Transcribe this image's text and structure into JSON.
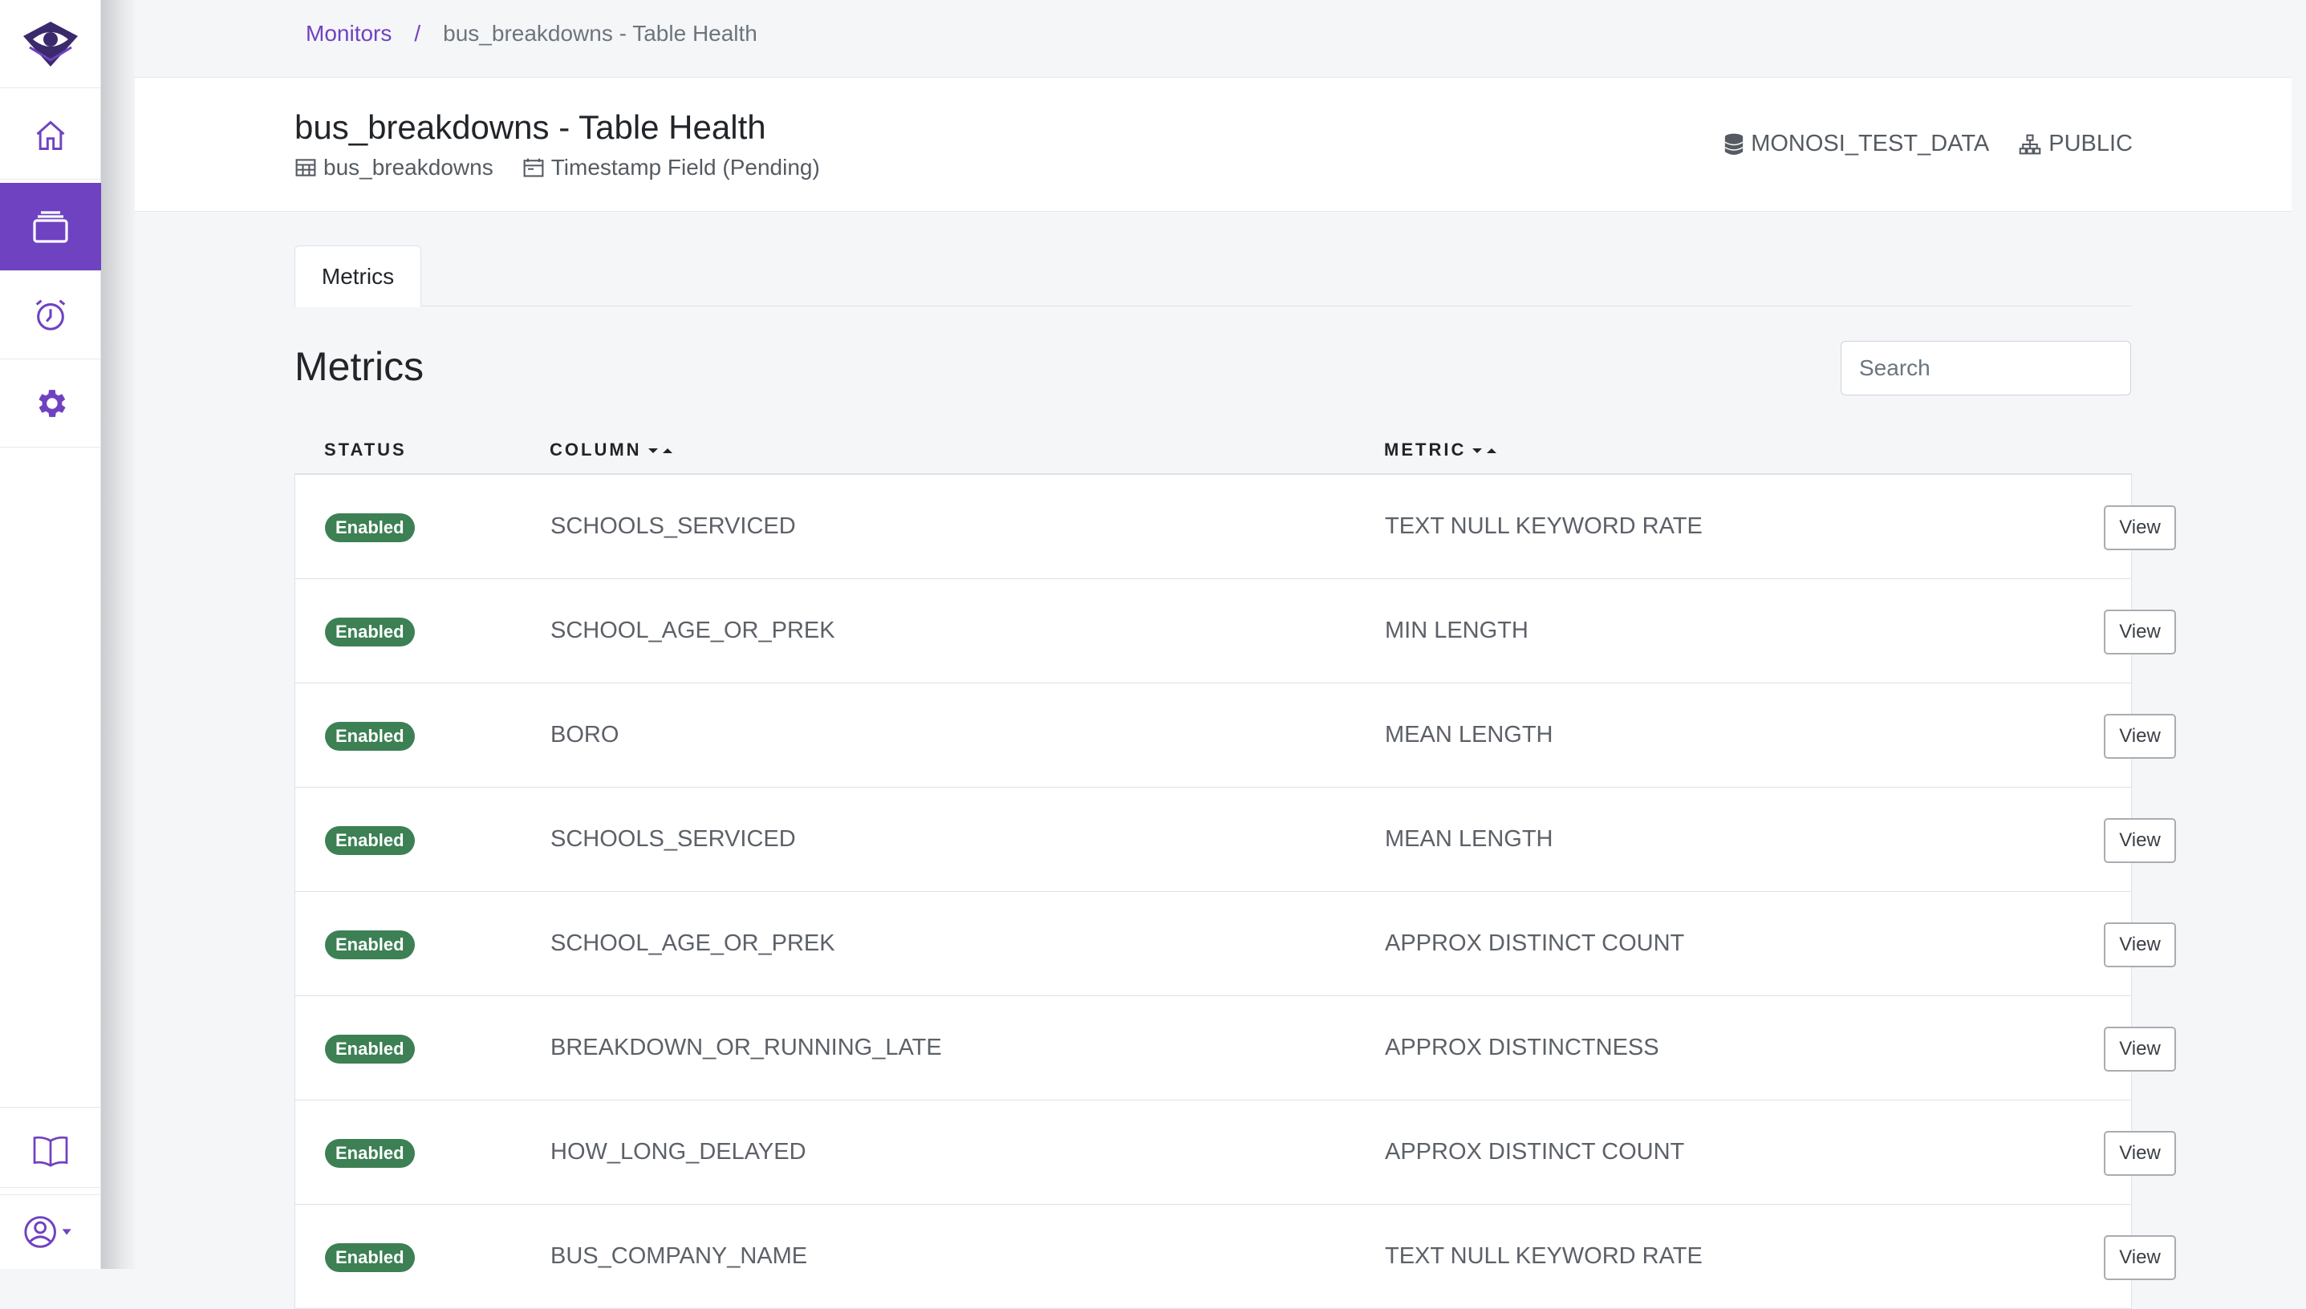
{
  "sidebar": {
    "items": [
      {
        "name": "logo-icon"
      },
      {
        "name": "home-icon"
      },
      {
        "name": "monitors-icon",
        "active": true
      },
      {
        "name": "alarm-clock-icon"
      },
      {
        "name": "gear-icon"
      },
      {
        "name": "book-icon"
      },
      {
        "name": "user-account-icon"
      }
    ],
    "accent_color": "#6f42c1"
  },
  "breadcrumb": {
    "root": "Monitors",
    "separator": "/",
    "current": "bus_breakdowns - Table Health"
  },
  "header": {
    "title": "bus_breakdowns - Table Health",
    "table_name": "bus_breakdowns",
    "timestamp_field": "Timestamp Field (Pending)",
    "database": "MONOSI_TEST_DATA",
    "schema": "PUBLIC"
  },
  "tabs": [
    {
      "label": "Metrics"
    }
  ],
  "section": {
    "title": "Metrics"
  },
  "search": {
    "placeholder": "Search",
    "value": ""
  },
  "table": {
    "headers": {
      "status": "STATUS",
      "column": "COLUMN",
      "metric": "METRIC"
    },
    "rows": [
      {
        "status": "Enabled",
        "column": "SCHOOLS_SERVICED",
        "metric": "TEXT NULL KEYWORD RATE",
        "action": "View"
      },
      {
        "status": "Enabled",
        "column": "SCHOOL_AGE_OR_PREK",
        "metric": "MIN LENGTH",
        "action": "View"
      },
      {
        "status": "Enabled",
        "column": "BORO",
        "metric": "MEAN LENGTH",
        "action": "View"
      },
      {
        "status": "Enabled",
        "column": "SCHOOLS_SERVICED",
        "metric": "MEAN LENGTH",
        "action": "View"
      },
      {
        "status": "Enabled",
        "column": "SCHOOL_AGE_OR_PREK",
        "metric": "APPROX DISTINCT COUNT",
        "action": "View"
      },
      {
        "status": "Enabled",
        "column": "BREAKDOWN_OR_RUNNING_LATE",
        "metric": "APPROX DISTINCTNESS",
        "action": "View"
      },
      {
        "status": "Enabled",
        "column": "HOW_LONG_DELAYED",
        "metric": "APPROX DISTINCT COUNT",
        "action": "View"
      },
      {
        "status": "Enabled",
        "column": "BUS_COMPANY_NAME",
        "metric": "TEXT NULL KEYWORD RATE",
        "action": "View"
      }
    ],
    "status_color": "#3c8054"
  }
}
